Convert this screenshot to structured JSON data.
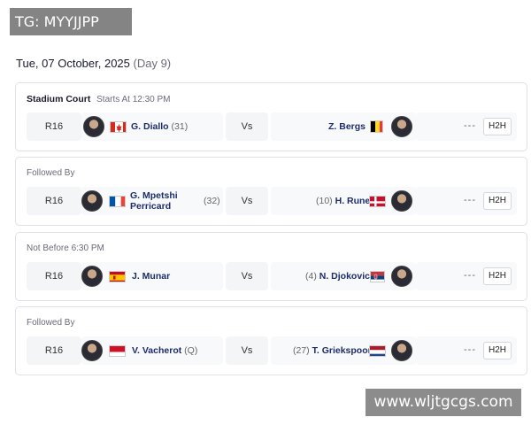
{
  "watermarks": {
    "top": "TG: MYYJJPP",
    "bottom": "www.wljtgcgs.com"
  },
  "date": {
    "label": "Tue, 07 October, 2025",
    "day": "(Day 9)"
  },
  "matches": [
    {
      "court": "Stadium Court",
      "time": "Starts At 12:30 PM",
      "round": "R16",
      "player1": {
        "name": "G. Diallo",
        "seed": "(31)",
        "flag": "canada"
      },
      "player2": {
        "name": "Z. Bergs",
        "seed": "",
        "flag": "belgium"
      },
      "vs": "Vs",
      "score": "---",
      "h2h": "H2H"
    },
    {
      "court": "",
      "time": "Followed By",
      "round": "R16",
      "player1": {
        "name_line1": "G. Mpetshi",
        "name_line2": "Perricard",
        "seed": "(32)",
        "flag": "france"
      },
      "player2": {
        "name": "H. Rune",
        "seed": "(10)",
        "flag": "denmark"
      },
      "vs": "Vs",
      "score": "---",
      "h2h": "H2H"
    },
    {
      "court": "",
      "time": "Not Before 6:30 PM",
      "round": "R16",
      "player1": {
        "name": "J. Munar",
        "seed": "",
        "flag": "spain"
      },
      "player2": {
        "name": "N. Djokovic",
        "seed": "(4)",
        "flag": "serbia"
      },
      "vs": "Vs",
      "score": "---",
      "h2h": "H2H"
    },
    {
      "court": "",
      "time": "Followed By",
      "round": "R16",
      "player1": {
        "name": "V. Vacherot",
        "seed": "(Q)",
        "flag": "monaco"
      },
      "player2": {
        "name": "T. Griekspoor",
        "seed": "(27)",
        "flag": "netherlands"
      },
      "vs": "Vs",
      "score": "---",
      "h2h": "H2H"
    }
  ]
}
